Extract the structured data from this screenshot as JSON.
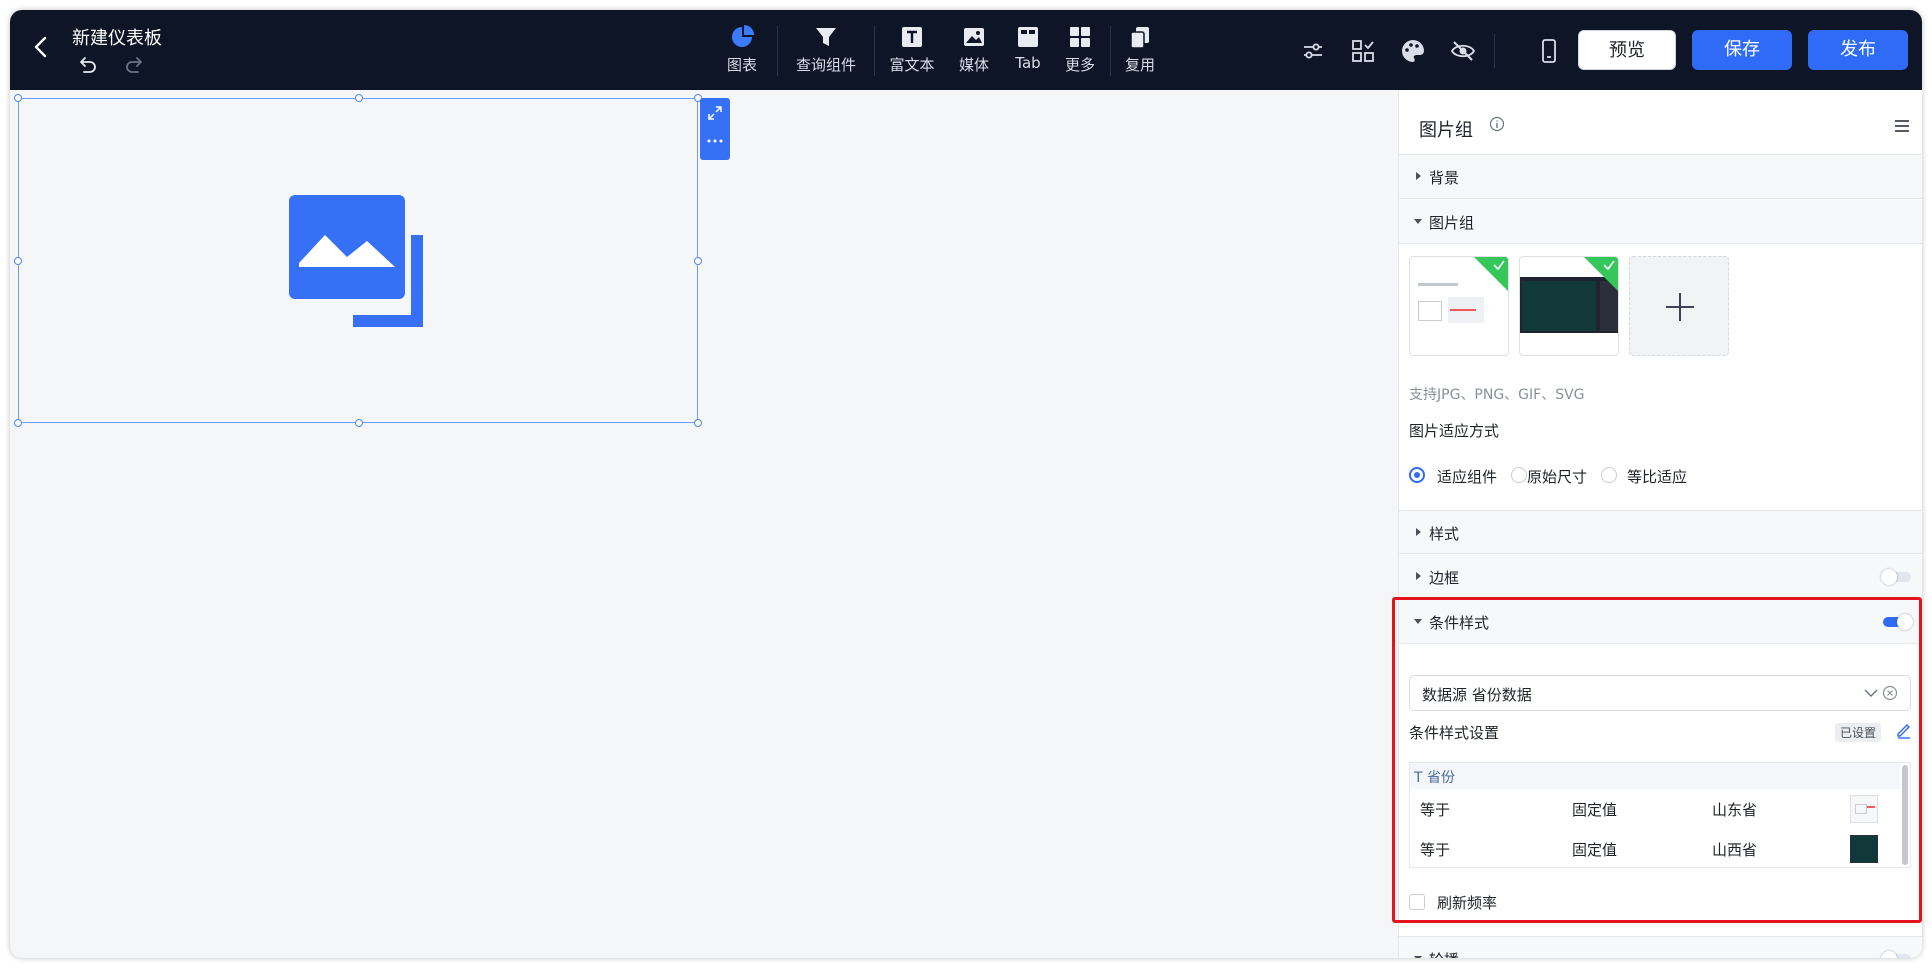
{
  "header": {
    "title": "新建仪表板",
    "tools": [
      {
        "id": "chart",
        "label": "图表"
      },
      {
        "id": "query",
        "label": "查询组件"
      },
      {
        "id": "richtext",
        "label": "富文本"
      },
      {
        "id": "media",
        "label": "媒体"
      },
      {
        "id": "tab",
        "label": "Tab"
      },
      {
        "id": "more",
        "label": "更多"
      },
      {
        "id": "reuse",
        "label": "复用"
      }
    ],
    "preview_label": "预览",
    "save_label": "保存",
    "publish_label": "发布"
  },
  "colors": {
    "topbar": "#0d1526",
    "primary": "#2f6bf7",
    "highlight": "#e5141c",
    "check": "#35c759"
  },
  "panel": {
    "title": "图片组",
    "sections": {
      "background": "背景",
      "image_group": "图片组",
      "style": "样式",
      "border": "边框",
      "conditional_style": "条件样式",
      "carousel": "轮播"
    },
    "formats_hint": "支持JPG、PNG、GIF、SVG",
    "fit_mode_label": "图片适应方式",
    "fit_options": [
      {
        "label": "适应组件",
        "selected": true
      },
      {
        "label": "原始尺寸",
        "selected": false
      },
      {
        "label": "等比适应",
        "selected": false
      }
    ],
    "border_enabled": false,
    "conditional_enabled": true,
    "carousel_enabled": false,
    "datasource_value": "数据源 省份数据",
    "cond_setting_label": "条件样式设置",
    "cond_setting_status": "已设置",
    "field_header": "T 省份",
    "rules": [
      {
        "op": "等于",
        "type": "固定值",
        "value": "山东省",
        "thumb": "light"
      },
      {
        "op": "等于",
        "type": "固定值",
        "value": "山西省",
        "thumb": "dark"
      }
    ],
    "refresh_label": "刷新频率",
    "refresh_checked": false
  }
}
